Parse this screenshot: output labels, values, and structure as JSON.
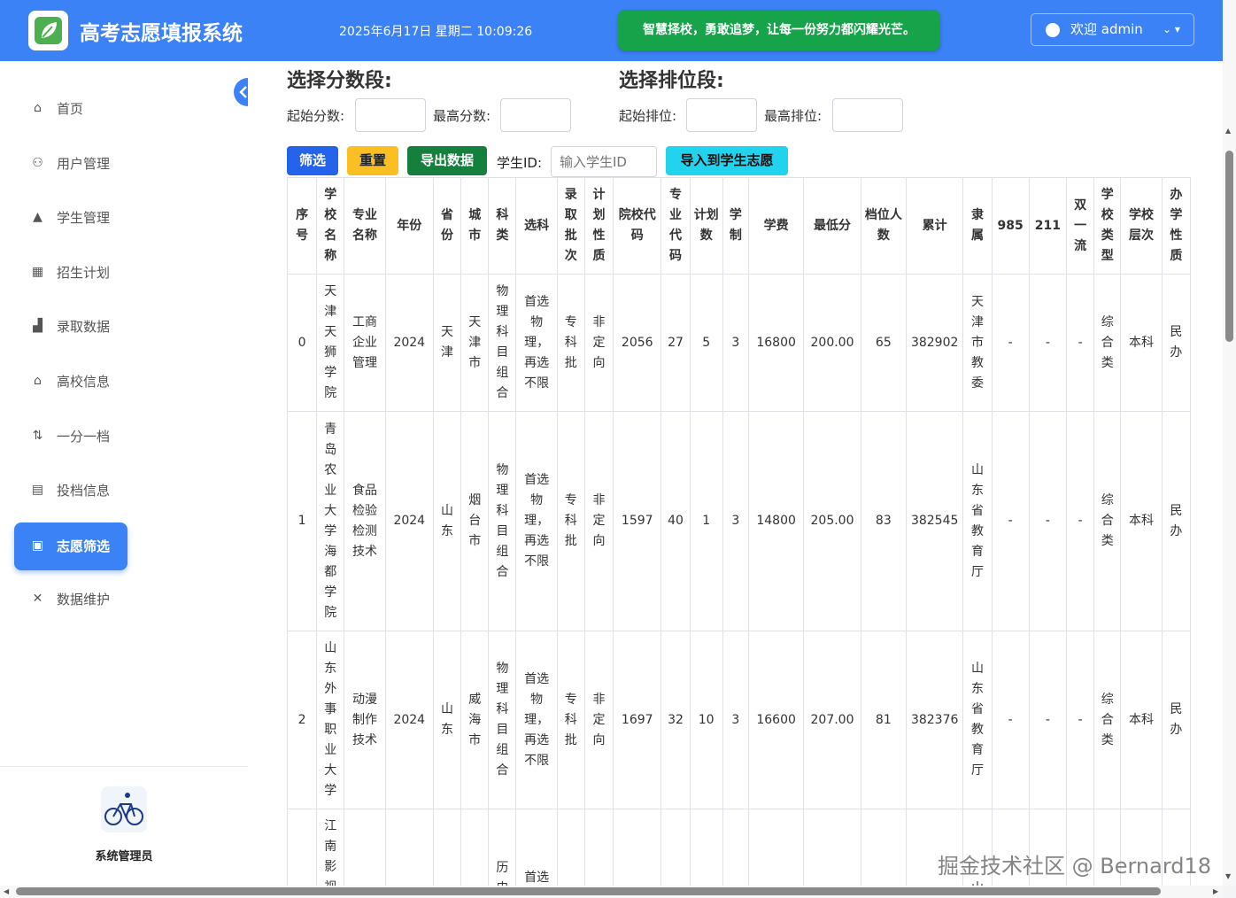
{
  "header": {
    "app_title": "高考志愿填报系统",
    "datetime": "2025年6月17日 星期二 10:09:26",
    "slogan": "智慧择校，勇敢追梦，让每一份努力都闪耀光芒。",
    "user_label": "欢迎 admin"
  },
  "sidebar": {
    "items": [
      {
        "label": "首页",
        "icon": "home-icon",
        "glyph": "⌂"
      },
      {
        "label": "用户管理",
        "icon": "users-icon",
        "glyph": "⚇"
      },
      {
        "label": "学生管理",
        "icon": "graduation-cap-icon",
        "glyph": "▲"
      },
      {
        "label": "招生计划",
        "icon": "calendar-icon",
        "glyph": "▦"
      },
      {
        "label": "录取数据",
        "icon": "bar-chart-icon",
        "glyph": "▟"
      },
      {
        "label": "高校信息",
        "icon": "university-icon",
        "glyph": "⌂"
      },
      {
        "label": "一分一档",
        "icon": "sort-icon",
        "glyph": "⇅"
      },
      {
        "label": "投档信息",
        "icon": "file-export-icon",
        "glyph": "▤"
      },
      {
        "label": "志愿筛选",
        "icon": "clipboard-icon",
        "glyph": "▣"
      },
      {
        "label": "数据维护",
        "icon": "tools-icon",
        "glyph": "✕"
      }
    ],
    "active_index": 8,
    "admin_name": "系统管理员"
  },
  "filters": {
    "score_title": "选择分数段:",
    "start_score_label": "起始分数:",
    "max_score_label": "最高分数:",
    "rank_title": "选择排位段:",
    "start_rank_label": "起始排位:",
    "max_rank_label": "最高排位:"
  },
  "actions": {
    "filter": "筛选",
    "reset": "重置",
    "export": "导出数据",
    "student_id_label": "学生ID:",
    "student_id_placeholder": "输入学生ID",
    "import": "导入到学生志愿"
  },
  "table": {
    "headers": [
      "序号",
      "学校名称",
      "专业名称",
      "年份",
      "省份",
      "城市",
      "科类",
      "选科",
      "录取批次",
      "计划性质",
      "院校代码",
      "专业代码",
      "计划数",
      "学制",
      "学费",
      "最低分",
      "档位人数",
      "累计",
      "隶属",
      "985",
      "211",
      "双一流",
      "学校类型",
      "学校层次",
      "办学性质"
    ],
    "rows": [
      [
        "0",
        "天津天狮学院",
        "工商企业管理",
        "2024",
        "天津",
        "天津市",
        "物理科目组合",
        "首选物理，再选不限",
        "专科批",
        "非定向",
        "2056",
        "27",
        "5",
        "3",
        "16800",
        "200.00",
        "65",
        "382902",
        "天津市教委",
        "-",
        "-",
        "-",
        "综合类",
        "本科",
        "民办"
      ],
      [
        "1",
        "青岛农业大学海都学院",
        "食品检验检测技术",
        "2024",
        "山东",
        "烟台市",
        "物理科目组合",
        "首选物理，再选不限",
        "专科批",
        "非定向",
        "1597",
        "40",
        "1",
        "3",
        "14800",
        "205.00",
        "83",
        "382545",
        "山东省教育厅",
        "-",
        "-",
        "-",
        "综合类",
        "本科",
        "民办"
      ],
      [
        "2",
        "山东外事职业大学",
        "动漫制作技术",
        "2024",
        "山东",
        "威海市",
        "物理科目组合",
        "首选物理，再选不限",
        "专科批",
        "非定向",
        "1697",
        "32",
        "10",
        "3",
        "16600",
        "207.00",
        "81",
        "382376",
        "山东省教育厅",
        "-",
        "-",
        "-",
        "综合类",
        "本科",
        "民办"
      ],
      [
        "",
        "江南影视",
        "",
        "",
        "",
        "",
        "历史",
        "首选",
        "",
        "",
        "",
        "",
        "",
        "",
        "",
        "",
        "",
        "",
        "山东",
        "",
        "",
        "",
        "",
        "",
        ""
      ]
    ]
  },
  "watermark": "掘金技术社区 @ Bernard18"
}
